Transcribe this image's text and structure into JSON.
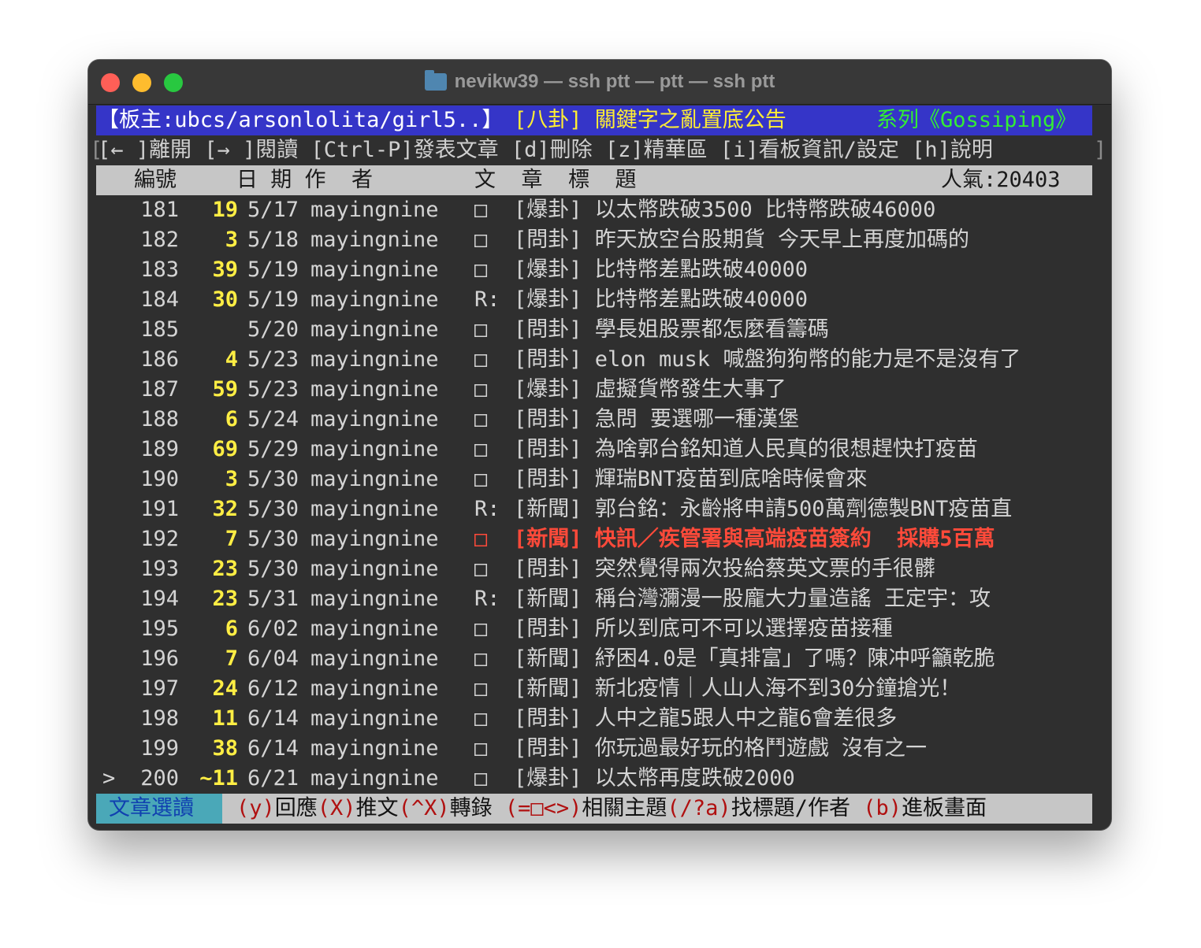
{
  "window": {
    "title": "nevikw39 — ssh ptt — ptt — ssh ptt"
  },
  "board_header": {
    "moderator": "【板主:ubcs/arsonlolita/girl5..】",
    "board_title": "[八卦] 關鍵字之亂置底公告",
    "series": "系列《Gossiping》"
  },
  "help_bar": {
    "open_bracket": "[",
    "text": "[← ]離開 [→ ]閱讀 [Ctrl-P]發表文章 [d]刪除 [z]精華區 [i]看板資訊/設定 [h]說明",
    "close_bracket": "]"
  },
  "columns": {
    "number": "編號",
    "date_author": "日 期 作  者",
    "title": "文  章  標  題",
    "popularity": "人氣:20403"
  },
  "posts": [
    {
      "num": "181",
      "push": "19",
      "date": "5/17",
      "author": "mayingnine",
      "mark": "□",
      "title": "[爆卦] 以太幣跌破3500 比特幣跌破46000"
    },
    {
      "num": "182",
      "push": "3",
      "date": "5/18",
      "author": "mayingnine",
      "mark": "□",
      "title": "[問卦] 昨天放空台股期貨 今天早上再度加碼的"
    },
    {
      "num": "183",
      "push": "39",
      "date": "5/19",
      "author": "mayingnine",
      "mark": "□",
      "title": "[爆卦] 比特幣差點跌破40000"
    },
    {
      "num": "184",
      "push": "30",
      "date": "5/19",
      "author": "mayingnine",
      "mark": "R:",
      "title": "[爆卦] 比特幣差點跌破40000"
    },
    {
      "num": "185",
      "push": "",
      "date": "5/20",
      "author": "mayingnine",
      "mark": "□",
      "title": "[問卦] 學長姐股票都怎麼看籌碼"
    },
    {
      "num": "186",
      "push": "4",
      "date": "5/23",
      "author": "mayingnine",
      "mark": "□",
      "title": "[問卦] elon musk 喊盤狗狗幣的能力是不是沒有了"
    },
    {
      "num": "187",
      "push": "59",
      "date": "5/23",
      "author": "mayingnine",
      "mark": "□",
      "title": "[爆卦] 虛擬貨幣發生大事了"
    },
    {
      "num": "188",
      "push": "6",
      "date": "5/24",
      "author": "mayingnine",
      "mark": "□",
      "title": "[問卦] 急問 要選哪一種漢堡"
    },
    {
      "num": "189",
      "push": "69",
      "date": "5/29",
      "author": "mayingnine",
      "mark": "□",
      "title": "[問卦] 為啥郭台銘知道人民真的很想趕快打疫苗"
    },
    {
      "num": "190",
      "push": "3",
      "date": "5/30",
      "author": "mayingnine",
      "mark": "□",
      "title": "[問卦] 輝瑞BNT疫苗到底啥時候會來"
    },
    {
      "num": "191",
      "push": "32",
      "date": "5/30",
      "author": "mayingnine",
      "mark": "R:",
      "title": "[新聞] 郭台銘：永齡將申請500萬劑德製BNT疫苗直"
    },
    {
      "num": "192",
      "push": "7",
      "date": "5/30",
      "author": "mayingnine",
      "mark": "□",
      "title": "[新聞] 快訊／疾管署與高端疫苗簽約  採購5百萬"
    },
    {
      "num": "193",
      "push": "23",
      "date": "5/30",
      "author": "mayingnine",
      "mark": "□",
      "title": "[問卦] 突然覺得兩次投給蔡英文票的手很髒"
    },
    {
      "num": "194",
      "push": "23",
      "date": "5/31",
      "author": "mayingnine",
      "mark": "R:",
      "title": "[新聞] 稱台灣瀰漫一股龐大力量造謠 王定宇：攻"
    },
    {
      "num": "195",
      "push": "6",
      "date": "6/02",
      "author": "mayingnine",
      "mark": "□",
      "title": "[問卦] 所以到底可不可以選擇疫苗接種"
    },
    {
      "num": "196",
      "push": "7",
      "date": "6/04",
      "author": "mayingnine",
      "mark": "□",
      "title": "[新聞] 紓困4.0是「真排富」了嗎？陳冲呼籲乾脆"
    },
    {
      "num": "197",
      "push": "24",
      "date": "6/12",
      "author": "mayingnine",
      "mark": "□",
      "title": "[新聞] 新北疫情｜人山人海不到30分鐘搶光！"
    },
    {
      "num": "198",
      "push": "11",
      "date": "6/14",
      "author": "mayingnine",
      "mark": "□",
      "title": "[問卦] 人中之龍5跟人中之龍6會差很多"
    },
    {
      "num": "199",
      "push": "38",
      "date": "6/14",
      "author": "mayingnine",
      "mark": "□",
      "title": "[問卦] 你玩過最好玩的格鬥遊戲 沒有之一"
    },
    {
      "num": "200",
      "push": "~11",
      "date": "6/21",
      "author": "mayingnine",
      "mark": "□",
      "title": "[爆卦] 以太幣再度跌破2000"
    }
  ],
  "cursor": ">",
  "highlight_color": "#ff4a3a",
  "status_bar": {
    "mode": "文章選讀",
    "k1": "(y)",
    "t1": "回應",
    "k2": "(X)",
    "t2": "推文",
    "k3": "(^X)",
    "t3": "轉錄",
    "k4": "(=□<>)",
    "t4": "相關主題",
    "k5": "(/?a)",
    "t5": "找標題/作者",
    "k6": "(b)",
    "t6": "進板畫面"
  }
}
